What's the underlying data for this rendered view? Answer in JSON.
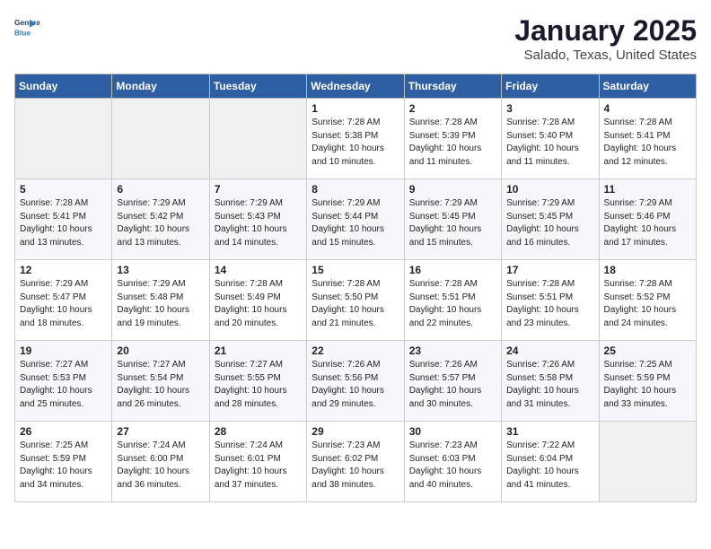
{
  "header": {
    "logo_line1": "General",
    "logo_line2": "Blue",
    "title": "January 2025",
    "subtitle": "Salado, Texas, United States"
  },
  "weekdays": [
    "Sunday",
    "Monday",
    "Tuesday",
    "Wednesday",
    "Thursday",
    "Friday",
    "Saturday"
  ],
  "weeks": [
    [
      {
        "day": "",
        "info": ""
      },
      {
        "day": "",
        "info": ""
      },
      {
        "day": "",
        "info": ""
      },
      {
        "day": "1",
        "info": "Sunrise: 7:28 AM\nSunset: 5:38 PM\nDaylight: 10 hours\nand 10 minutes."
      },
      {
        "day": "2",
        "info": "Sunrise: 7:28 AM\nSunset: 5:39 PM\nDaylight: 10 hours\nand 11 minutes."
      },
      {
        "day": "3",
        "info": "Sunrise: 7:28 AM\nSunset: 5:40 PM\nDaylight: 10 hours\nand 11 minutes."
      },
      {
        "day": "4",
        "info": "Sunrise: 7:28 AM\nSunset: 5:41 PM\nDaylight: 10 hours\nand 12 minutes."
      }
    ],
    [
      {
        "day": "5",
        "info": "Sunrise: 7:28 AM\nSunset: 5:41 PM\nDaylight: 10 hours\nand 13 minutes."
      },
      {
        "day": "6",
        "info": "Sunrise: 7:29 AM\nSunset: 5:42 PM\nDaylight: 10 hours\nand 13 minutes."
      },
      {
        "day": "7",
        "info": "Sunrise: 7:29 AM\nSunset: 5:43 PM\nDaylight: 10 hours\nand 14 minutes."
      },
      {
        "day": "8",
        "info": "Sunrise: 7:29 AM\nSunset: 5:44 PM\nDaylight: 10 hours\nand 15 minutes."
      },
      {
        "day": "9",
        "info": "Sunrise: 7:29 AM\nSunset: 5:45 PM\nDaylight: 10 hours\nand 15 minutes."
      },
      {
        "day": "10",
        "info": "Sunrise: 7:29 AM\nSunset: 5:45 PM\nDaylight: 10 hours\nand 16 minutes."
      },
      {
        "day": "11",
        "info": "Sunrise: 7:29 AM\nSunset: 5:46 PM\nDaylight: 10 hours\nand 17 minutes."
      }
    ],
    [
      {
        "day": "12",
        "info": "Sunrise: 7:29 AM\nSunset: 5:47 PM\nDaylight: 10 hours\nand 18 minutes."
      },
      {
        "day": "13",
        "info": "Sunrise: 7:29 AM\nSunset: 5:48 PM\nDaylight: 10 hours\nand 19 minutes."
      },
      {
        "day": "14",
        "info": "Sunrise: 7:28 AM\nSunset: 5:49 PM\nDaylight: 10 hours\nand 20 minutes."
      },
      {
        "day": "15",
        "info": "Sunrise: 7:28 AM\nSunset: 5:50 PM\nDaylight: 10 hours\nand 21 minutes."
      },
      {
        "day": "16",
        "info": "Sunrise: 7:28 AM\nSunset: 5:51 PM\nDaylight: 10 hours\nand 22 minutes."
      },
      {
        "day": "17",
        "info": "Sunrise: 7:28 AM\nSunset: 5:51 PM\nDaylight: 10 hours\nand 23 minutes."
      },
      {
        "day": "18",
        "info": "Sunrise: 7:28 AM\nSunset: 5:52 PM\nDaylight: 10 hours\nand 24 minutes."
      }
    ],
    [
      {
        "day": "19",
        "info": "Sunrise: 7:27 AM\nSunset: 5:53 PM\nDaylight: 10 hours\nand 25 minutes."
      },
      {
        "day": "20",
        "info": "Sunrise: 7:27 AM\nSunset: 5:54 PM\nDaylight: 10 hours\nand 26 minutes."
      },
      {
        "day": "21",
        "info": "Sunrise: 7:27 AM\nSunset: 5:55 PM\nDaylight: 10 hours\nand 28 minutes."
      },
      {
        "day": "22",
        "info": "Sunrise: 7:26 AM\nSunset: 5:56 PM\nDaylight: 10 hours\nand 29 minutes."
      },
      {
        "day": "23",
        "info": "Sunrise: 7:26 AM\nSunset: 5:57 PM\nDaylight: 10 hours\nand 30 minutes."
      },
      {
        "day": "24",
        "info": "Sunrise: 7:26 AM\nSunset: 5:58 PM\nDaylight: 10 hours\nand 31 minutes."
      },
      {
        "day": "25",
        "info": "Sunrise: 7:25 AM\nSunset: 5:59 PM\nDaylight: 10 hours\nand 33 minutes."
      }
    ],
    [
      {
        "day": "26",
        "info": "Sunrise: 7:25 AM\nSunset: 5:59 PM\nDaylight: 10 hours\nand 34 minutes."
      },
      {
        "day": "27",
        "info": "Sunrise: 7:24 AM\nSunset: 6:00 PM\nDaylight: 10 hours\nand 36 minutes."
      },
      {
        "day": "28",
        "info": "Sunrise: 7:24 AM\nSunset: 6:01 PM\nDaylight: 10 hours\nand 37 minutes."
      },
      {
        "day": "29",
        "info": "Sunrise: 7:23 AM\nSunset: 6:02 PM\nDaylight: 10 hours\nand 38 minutes."
      },
      {
        "day": "30",
        "info": "Sunrise: 7:23 AM\nSunset: 6:03 PM\nDaylight: 10 hours\nand 40 minutes."
      },
      {
        "day": "31",
        "info": "Sunrise: 7:22 AM\nSunset: 6:04 PM\nDaylight: 10 hours\nand 41 minutes."
      },
      {
        "day": "",
        "info": ""
      }
    ]
  ]
}
